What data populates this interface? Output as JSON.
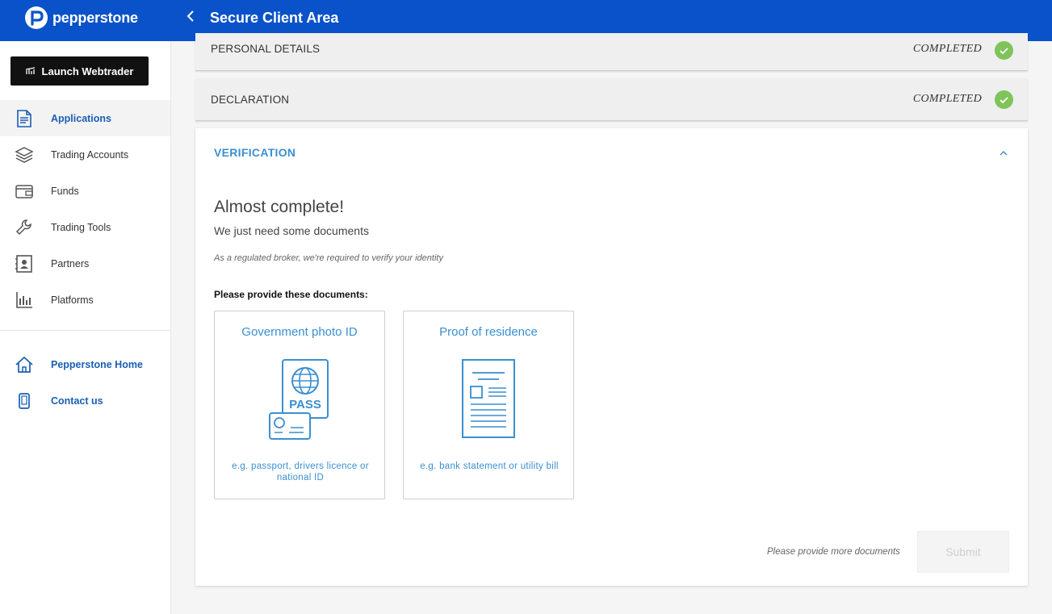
{
  "brand": {
    "name": "pepperstone",
    "primary_color": "#0a52c9",
    "accent_color": "#3a8fd1",
    "success_color": "#7fc45a"
  },
  "header": {
    "title": "Secure Client Area",
    "back_icon": "chevron-left-icon"
  },
  "sidebar": {
    "launch_label": "Launch Webtrader",
    "items": [
      {
        "label": "Applications",
        "icon": "document-icon",
        "active": true
      },
      {
        "label": "Trading Accounts",
        "icon": "layers-icon"
      },
      {
        "label": "Funds",
        "icon": "wallet-icon"
      },
      {
        "label": "Trading Tools",
        "icon": "wrench-icon"
      },
      {
        "label": "Partners",
        "icon": "contact-card-icon"
      },
      {
        "label": "Platforms",
        "icon": "bar-chart-icon"
      }
    ],
    "secondary": [
      {
        "label": "Pepperstone Home",
        "icon": "home-icon"
      },
      {
        "label": "Contact us",
        "icon": "phone-icon"
      }
    ]
  },
  "sections": {
    "personal": {
      "title": "PERSONAL DETAILS",
      "status": "COMPLETED"
    },
    "declaration": {
      "title": "DECLARATION",
      "status": "COMPLETED"
    },
    "verification": {
      "title": "VERIFICATION",
      "heading": "Almost complete!",
      "subheading": "We just need some documents",
      "note": "As a regulated broker, we're required to verify your identity",
      "provide_label": "Please provide these documents:",
      "documents": [
        {
          "title": "Government photo ID",
          "description": "e.g. passport, drivers licence or national ID",
          "icon": "passport-id-icon"
        },
        {
          "title": "Proof of residence",
          "description": "e.g. bank statement or utility bill",
          "icon": "document-statement-icon"
        }
      ],
      "passport_text": "PASS",
      "more_docs_message": "Please provide more documents",
      "submit_label": "Submit"
    }
  }
}
